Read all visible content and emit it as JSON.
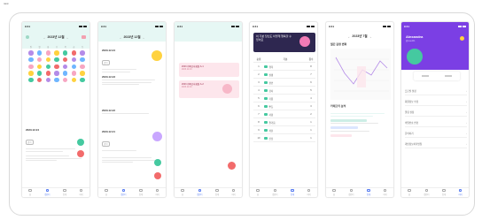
{
  "corner_label": "new",
  "status_time": "9:41",
  "screens": {
    "s1": {
      "month": "2023년 12월",
      "weekdays": [
        "일",
        "월",
        "화",
        "수",
        "목",
        "금",
        "토"
      ],
      "entries": [
        {
          "date": "2023.12.24",
          "tag": "감기"
        }
      ],
      "nav": [
        "홈",
        "캘린더",
        "통계",
        "마이"
      ]
    },
    "s2": {
      "month": "2023년 12월",
      "entries": [
        {
          "date": "2023.12.24",
          "tag": "감기"
        },
        {
          "date": "2023.12.23",
          "tag": ""
        },
        {
          "date": "2023.12.22",
          "tag": ""
        },
        {
          "date": "2023.12.21",
          "tag": "감기"
        }
      ],
      "nav": [
        "홈",
        "캘린더",
        "통계",
        "마이"
      ]
    },
    "s3": {
      "cards": [
        {
          "title": "2023 카톡조사회원 A-1",
          "sub": "2023.12.24"
        },
        {
          "title": "2023 카톡조사회원 A-2",
          "sub": "2023.12.24"
        }
      ],
      "nav": [
        "홈",
        "캘린더",
        "통계",
        "마이"
      ]
    },
    "s4": {
      "banner": "이 기분 당신도 이렇게 행복할 수 있어요",
      "headers": [
        "순위",
        "기분",
        "횟수"
      ],
      "rows": [
        {
          "rank": "1",
          "name": "행복",
          "count": "8"
        },
        {
          "rank": "2",
          "name": "설렘",
          "count": "7"
        },
        {
          "rank": "3",
          "name": "편안",
          "count": "6"
        },
        {
          "rank": "4",
          "name": "감사",
          "count": "5"
        },
        {
          "rank": "5",
          "name": "기쁨",
          "count": "4"
        },
        {
          "rank": "6",
          "name": "뿌듯",
          "count": "3"
        },
        {
          "rank": "7",
          "name": "사랑",
          "count": "2"
        },
        {
          "rank": "8",
          "name": "즐거움",
          "count": "1"
        },
        {
          "rank": "9",
          "name": "차분",
          "count": "1"
        },
        {
          "rank": "10",
          "name": "신남",
          "count": "1"
        }
      ],
      "nav": [
        "홈",
        "캘린더",
        "통계",
        "마이"
      ]
    },
    "s5": {
      "month": "2023년 7월",
      "chart_title": "월간 감정 변화",
      "section2": "카테고리 분석",
      "nav": [
        "홈",
        "캘린더",
        "통계",
        "마이"
      ]
    },
    "s6": {
      "name": "Alexandra",
      "handle": "@user01",
      "settings": [
        "프로필 설정",
        "회원정보 수정",
        "알림 설정",
        "비밀번호 변경",
        "문의하기",
        "개인정보처리방침"
      ],
      "nav": [
        "홈",
        "캘린더",
        "통계",
        "마이"
      ]
    }
  },
  "colors": {
    "mint": "#e6f7f4",
    "pink": "#fde6ec",
    "purple": "#7b3fe4",
    "green": "#45c9a0",
    "coral": "#f26b6b",
    "blue": "#5a7df0"
  }
}
